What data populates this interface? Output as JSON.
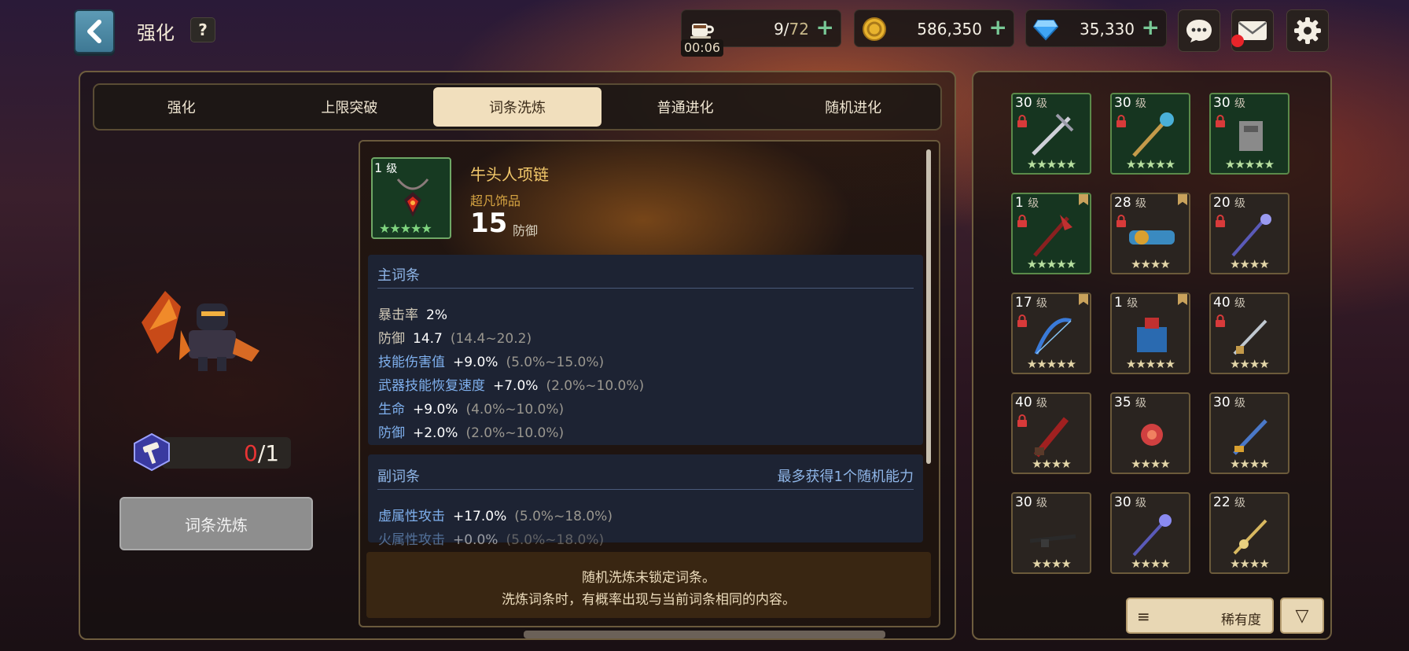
{
  "header": {
    "title": "强化",
    "help_label": "?",
    "stamina": {
      "current": "9",
      "sep": "/",
      "max": "72",
      "timer": "00:06"
    },
    "gold": "586,350",
    "gems": "35,330",
    "plus": "+"
  },
  "tabs": [
    {
      "label": "强化"
    },
    {
      "label": "上限突破"
    },
    {
      "label": "词条洗炼"
    },
    {
      "label": "普通进化"
    },
    {
      "label": "随机进化"
    }
  ],
  "active_tab": 2,
  "cost": {
    "have": "0",
    "need": "/1"
  },
  "refine_button": "词条洗炼",
  "item": {
    "level": "1",
    "level_unit": "级",
    "stars": "★★★★★",
    "name": "牛头人项链",
    "rarity": "超凡饰品",
    "stat_value": "15",
    "stat_label": "防御"
  },
  "main_attrs": {
    "header": "主词条",
    "rows": [
      {
        "name": "暴击率",
        "value": "2%",
        "range": ""
      },
      {
        "name": "防御",
        "value": "14.7",
        "range": "(14.4~20.2)"
      },
      {
        "name": "技能伤害值",
        "value": "+9.0%",
        "range": "(5.0%~15.0%)"
      },
      {
        "name": "武器技能恢复速度",
        "value": "+7.0%",
        "range": "(2.0%~10.0%)"
      },
      {
        "name": "生命",
        "value": "+9.0%",
        "range": "(4.0%~10.0%)"
      },
      {
        "name": "防御",
        "value": "+2.0%",
        "range": "(2.0%~10.0%)"
      }
    ]
  },
  "sub_attrs": {
    "header": "副词条",
    "note": "最多获得1个随机能力",
    "rows": [
      {
        "name": "虚属性攻击",
        "value": "+17.0%",
        "range": "(5.0%~18.0%)"
      },
      {
        "name": "火属性攻击",
        "value": "+0.0%",
        "range": "(5.0%~18.0%)"
      }
    ]
  },
  "notice": {
    "line1": "随机洗炼未锁定词条。",
    "line2": "洗炼词条时，有概率出现与当前词条相同的内容。"
  },
  "inventory": [
    {
      "level": "30",
      "stars": "★★★★★",
      "locked": true,
      "marked": false,
      "green": true
    },
    {
      "level": "30",
      "stars": "★★★★★",
      "locked": true,
      "marked": false,
      "green": true
    },
    {
      "level": "30",
      "stars": "★★★★★",
      "locked": true,
      "marked": false,
      "green": true
    },
    {
      "level": "1",
      "stars": "★★★★★",
      "locked": true,
      "marked": true,
      "green": true
    },
    {
      "level": "28",
      "stars": "★★★★",
      "locked": true,
      "marked": true,
      "green": false
    },
    {
      "level": "20",
      "stars": "★★★★",
      "locked": true,
      "marked": false,
      "green": false
    },
    {
      "level": "17",
      "stars": "★★★★★",
      "locked": true,
      "marked": true,
      "green": false
    },
    {
      "level": "1",
      "stars": "★★★★★",
      "locked": false,
      "marked": true,
      "green": false
    },
    {
      "level": "40",
      "stars": "★★★★",
      "locked": true,
      "marked": false,
      "green": false
    },
    {
      "level": "40",
      "stars": "★★★★",
      "locked": true,
      "marked": false,
      "green": false
    },
    {
      "level": "35",
      "stars": "★★★★",
      "locked": false,
      "marked": false,
      "green": false
    },
    {
      "level": "30",
      "stars": "★★★★",
      "locked": false,
      "marked": false,
      "green": false
    },
    {
      "level": "30",
      "stars": "★★★★",
      "locked": false,
      "marked": false,
      "green": false
    },
    {
      "level": "30",
      "stars": "★★★★",
      "locked": false,
      "marked": false,
      "green": false
    },
    {
      "level": "22",
      "stars": "★★★★",
      "locked": false,
      "marked": false,
      "green": false
    }
  ],
  "sort": {
    "label": "稀有度",
    "menu_icon": "≡",
    "filter_icon": "▽"
  },
  "icons": [
    "back-icon",
    "coffee-icon",
    "coin-icon",
    "diamond-icon",
    "chat-icon",
    "mail-icon",
    "gear-icon",
    "lock-icon",
    "hammer-icon"
  ],
  "colors": {
    "tab_active": "#f1dfbd",
    "attr_blue": "#7fb0ee",
    "gold_name": "#f2c86b",
    "alert_red": "#e8242a"
  }
}
